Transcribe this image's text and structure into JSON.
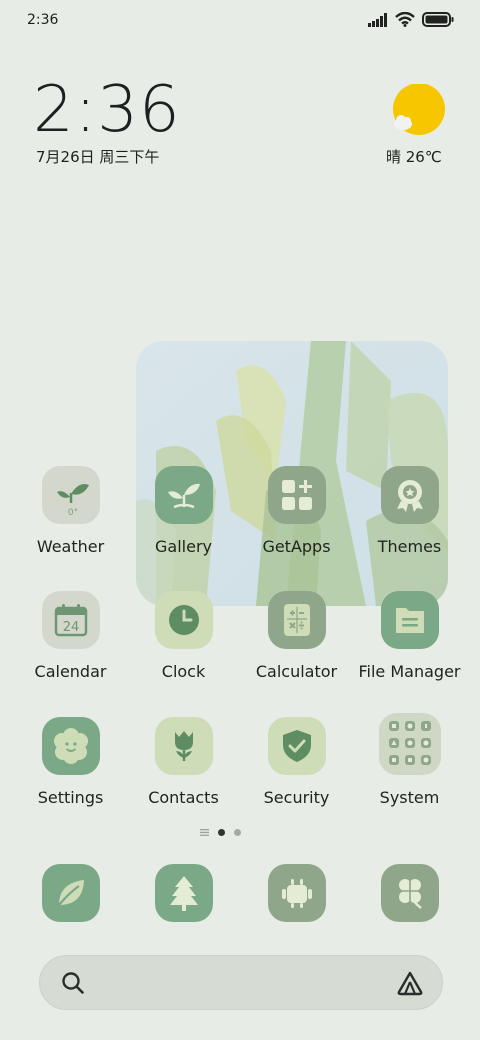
{
  "status_bar": {
    "time": "2:36"
  },
  "clock_widget": {
    "time": "2:36",
    "date": "7月26日 周三下午"
  },
  "weather_widget": {
    "text": "晴 26℃"
  },
  "apps": [
    {
      "label": "Weather",
      "icon": "sprout-weather-icon"
    },
    {
      "label": "Gallery",
      "icon": "sprout-icon"
    },
    {
      "label": "GetApps",
      "icon": "grid-plus-icon"
    },
    {
      "label": "Themes",
      "icon": "badge-icon"
    },
    {
      "label": "Calendar",
      "icon": "calendar-icon",
      "day": "24"
    },
    {
      "label": "Clock",
      "icon": "clock-icon"
    },
    {
      "label": "Calculator",
      "icon": "calculator-icon"
    },
    {
      "label": "File Manager",
      "icon": "folder-icon"
    },
    {
      "label": "Settings",
      "icon": "flower-face-icon"
    },
    {
      "label": "Contacts",
      "icon": "tulip-icon"
    },
    {
      "label": "Security",
      "icon": "shield-check-icon"
    },
    {
      "label": "System",
      "icon": "folder-grid-icon"
    }
  ],
  "weather_app_temp": "0°",
  "dock": [
    "leaf-icon",
    "tree-icon",
    "android-icon",
    "clover-icon"
  ],
  "page_indicator": {
    "pages": 2,
    "active": 1
  },
  "colors": {
    "background": "#e7ece6",
    "icon_dark_green": "#7ba886",
    "icon_mid_green": "#8fa68a",
    "icon_light_green": "#cfdcb8",
    "icon_grey": "#d4d8cc",
    "sun": "#f6c700"
  }
}
